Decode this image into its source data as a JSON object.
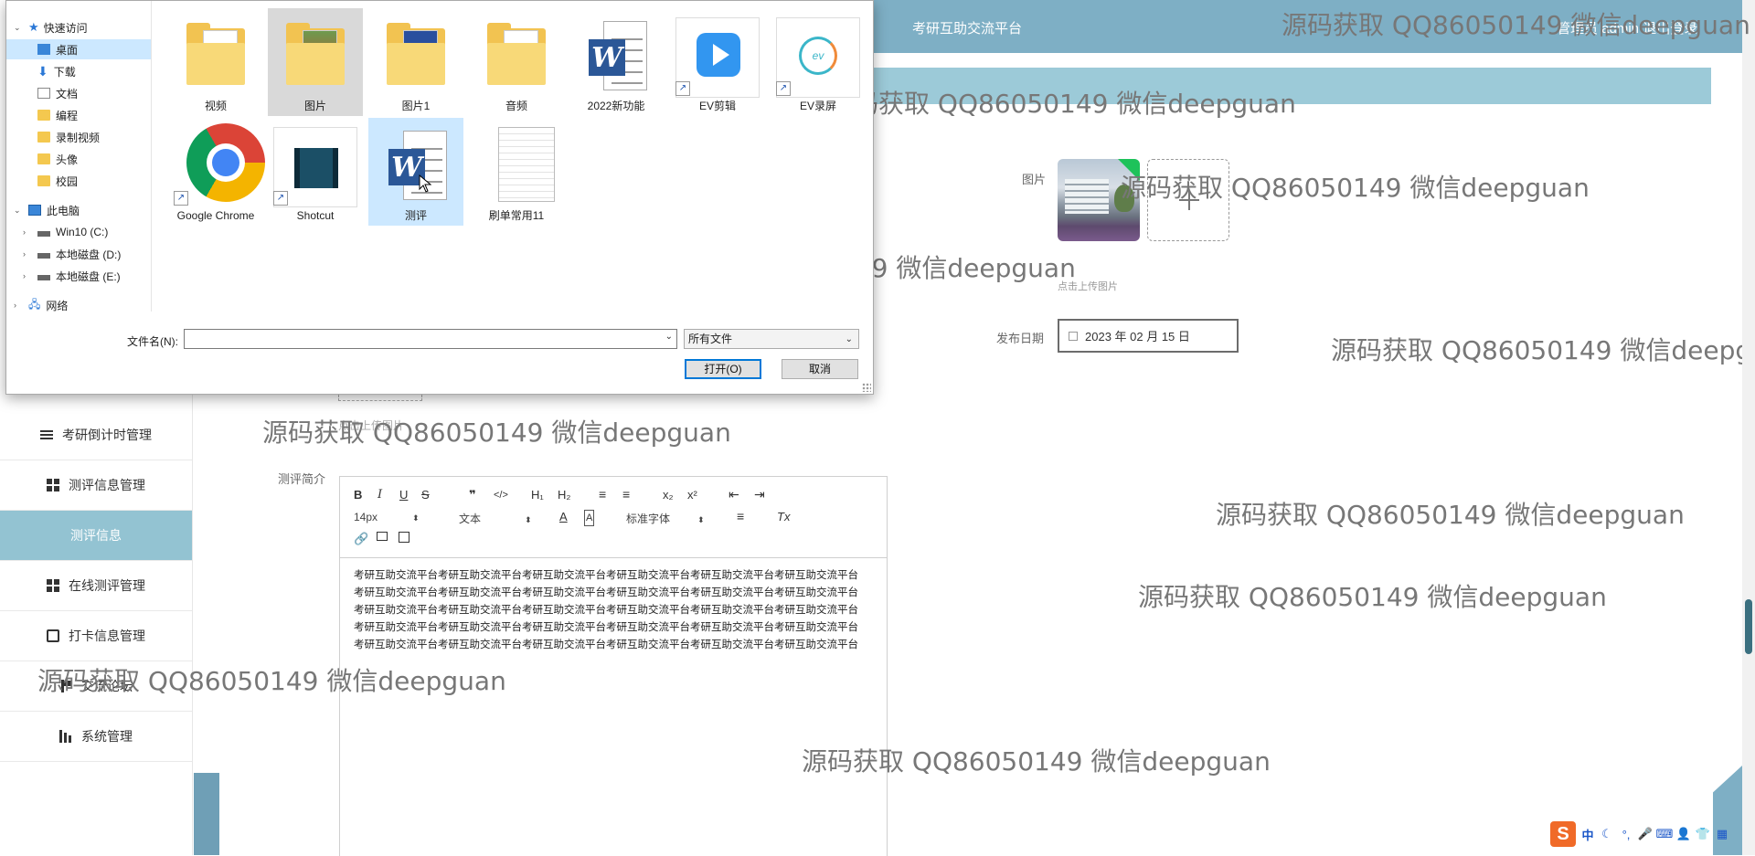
{
  "header": {
    "title": "考研互助交流平台",
    "user": "管理员 admin  退出登录"
  },
  "sidebar": {
    "items": [
      {
        "label": "考研倒计时管理",
        "icon": "list-icon"
      },
      {
        "label": "测评信息管理",
        "icon": "grid-icon"
      },
      {
        "label": "测评信息",
        "icon": ""
      },
      {
        "label": "在线测评管理",
        "icon": "grid-icon"
      },
      {
        "label": "打卡信息管理",
        "icon": "clipboard-icon"
      },
      {
        "label": "交流论坛",
        "icon": "flag-icon"
      },
      {
        "label": "系统管理",
        "icon": "bars-icon"
      }
    ]
  },
  "form": {
    "image_label": "图片",
    "upload_hint": "点击上传图片",
    "date_label": "发布日期",
    "date_value": "2023 年 02 月 15 日",
    "prev_upload_hint": "点击上传图片",
    "intro_label": "测评简介"
  },
  "editor": {
    "font_size": "14px",
    "block_type": "文本",
    "font_family": "标准字体",
    "toolbar_labels": {
      "bold": "B",
      "italic": "I",
      "underline": "U",
      "strike": "S",
      "quote": "❞",
      "code": "</>",
      "h1": "H₁",
      "h2": "H₂",
      "sub": "x₂",
      "sup": "x²",
      "clear": "Tx"
    },
    "content": "考研互助交流平台考研互助交流平台考研互助交流平台考研互助交流平台考研互助交流平台考研互助交流平台考研互助交流平台考研互助交流平台考研互助交流平台考研互助交流平台考研互助交流平台考研互助交流平台考研互助交流平台考研互助交流平台考研互助交流平台考研互助交流平台考研互助交流平台考研互助交流平台考研互助交流平台考研互助交流平台考研互助交流平台考研互助交流平台考研互助交流平台考研互助交流平台考研互助交流平台考研互助交流平台考研互助交流平台考研互助交流平台考研互助交流平台考研互助交流平台"
  },
  "watermark": "源码获取 QQ86050149 微信deepguan",
  "dialog": {
    "nav": {
      "quick_access": "快速访问",
      "desktop": "桌面",
      "downloads": "下载",
      "documents": "文档",
      "programming": "编程",
      "recordings": "录制视频",
      "avatar": "头像",
      "campus": "校园",
      "this_pc": "此电脑",
      "drive_c": "Win10 (C:)",
      "drive_d": "本地磁盘 (D:)",
      "drive_e": "本地磁盘 (E:)",
      "network": "网络"
    },
    "files": [
      {
        "name": "视频",
        "type": "folder"
      },
      {
        "name": "图片",
        "type": "folder"
      },
      {
        "name": "图片1",
        "type": "folder"
      },
      {
        "name": "音频",
        "type": "folder"
      },
      {
        "name": "2022新功能",
        "type": "word"
      },
      {
        "name": "EV剪辑",
        "type": "app"
      },
      {
        "name": "EV录屏",
        "type": "app"
      },
      {
        "name": "Google Chrome",
        "type": "chrome"
      },
      {
        "name": "Shotcut",
        "type": "app"
      },
      {
        "name": "测评",
        "type": "word"
      },
      {
        "name": "刷单常用11",
        "type": "text"
      }
    ],
    "filename_label": "文件名(N):",
    "filename_value": "",
    "filetype_value": "所有文件",
    "open_button": "打开(O)",
    "cancel_button": "取消"
  },
  "ime": {
    "mode": "中"
  }
}
